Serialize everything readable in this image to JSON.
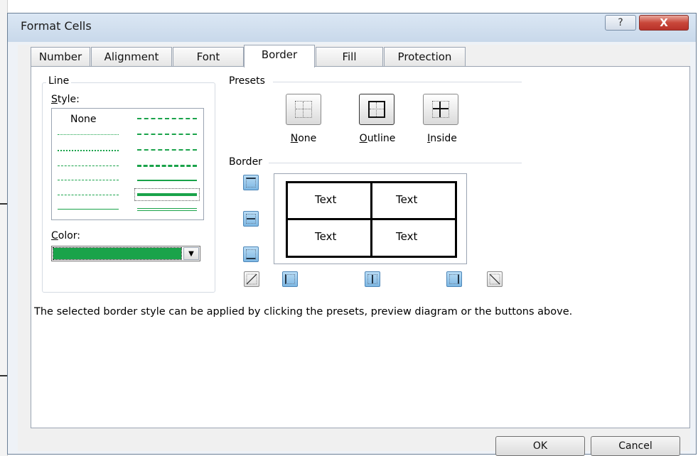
{
  "window": {
    "title": "Format Cells",
    "help_glyph": "?",
    "close_glyph": "X",
    "accent_color": "#c9473a"
  },
  "tabs": [
    {
      "label": "Number",
      "active": false
    },
    {
      "label": "Alignment",
      "active": false
    },
    {
      "label": "Font",
      "active": false
    },
    {
      "label": "Border",
      "active": true
    },
    {
      "label": "Fill",
      "active": false
    },
    {
      "label": "Protection",
      "active": false
    }
  ],
  "line": {
    "group_label": "Line",
    "style_label": "Style:",
    "none_label": "None",
    "color_label": "Color:",
    "selected_color": "#1aa34a",
    "dropdown_icon": "dropdown-arrow-icon"
  },
  "presets": {
    "group_label": "Presets",
    "items": [
      {
        "label": "None",
        "icon": "preset-none-icon"
      },
      {
        "label": "Outline",
        "icon": "preset-outline-icon"
      },
      {
        "label": "Inside",
        "icon": "preset-inside-icon"
      }
    ]
  },
  "border": {
    "group_label": "Border",
    "cell_text": [
      "Text",
      "Text",
      "Text",
      "Text"
    ]
  },
  "hint_text": "The selected border style can be applied by clicking the presets, preview diagram or the buttons above.",
  "buttons": {
    "ok": "OK",
    "cancel": "Cancel"
  }
}
